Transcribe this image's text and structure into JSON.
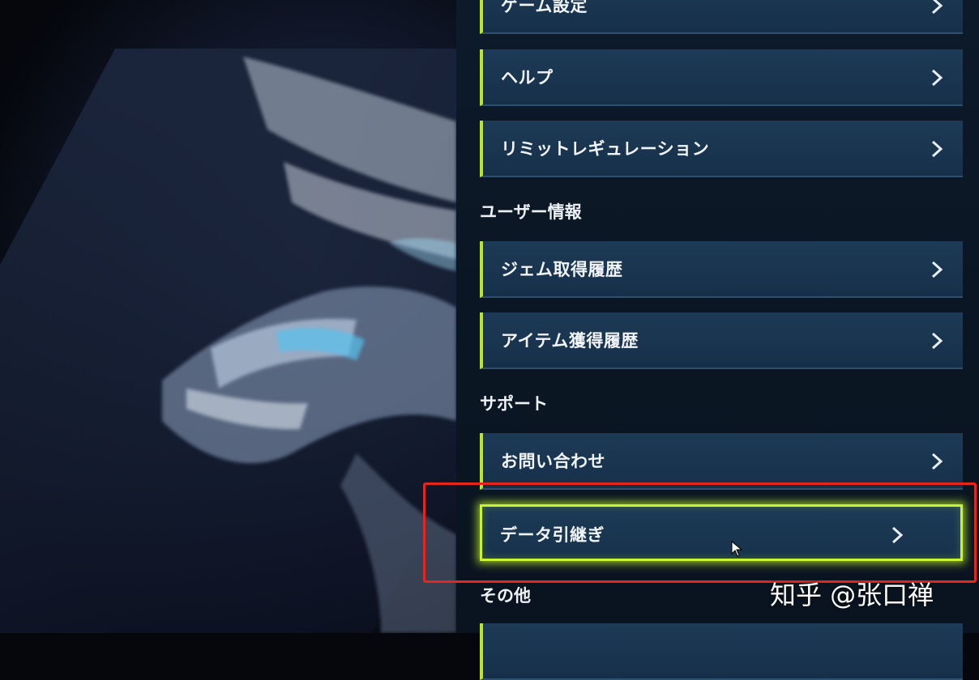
{
  "menu": {
    "items_top": [
      {
        "label": "ゲーム設定"
      },
      {
        "label": "ヘルプ"
      },
      {
        "label": "リミットレギュレーション"
      }
    ],
    "section_user": "ユーザー情報",
    "items_user": [
      {
        "label": "ジェム取得履歴"
      },
      {
        "label": "アイテム獲得履歴"
      }
    ],
    "section_support": "サポート",
    "items_support": [
      {
        "label": "お問い合わせ"
      },
      {
        "label": "データ引継ぎ"
      }
    ],
    "section_other": "その他"
  },
  "icons": {
    "chevron": "chevron-right-icon",
    "cursor": "mouse-pointer-icon"
  },
  "colors": {
    "accent": "#b9e62b",
    "highlight_box": "#e5261c",
    "item_bg": "#1d3a56"
  },
  "watermark": "知乎 @张口禅"
}
